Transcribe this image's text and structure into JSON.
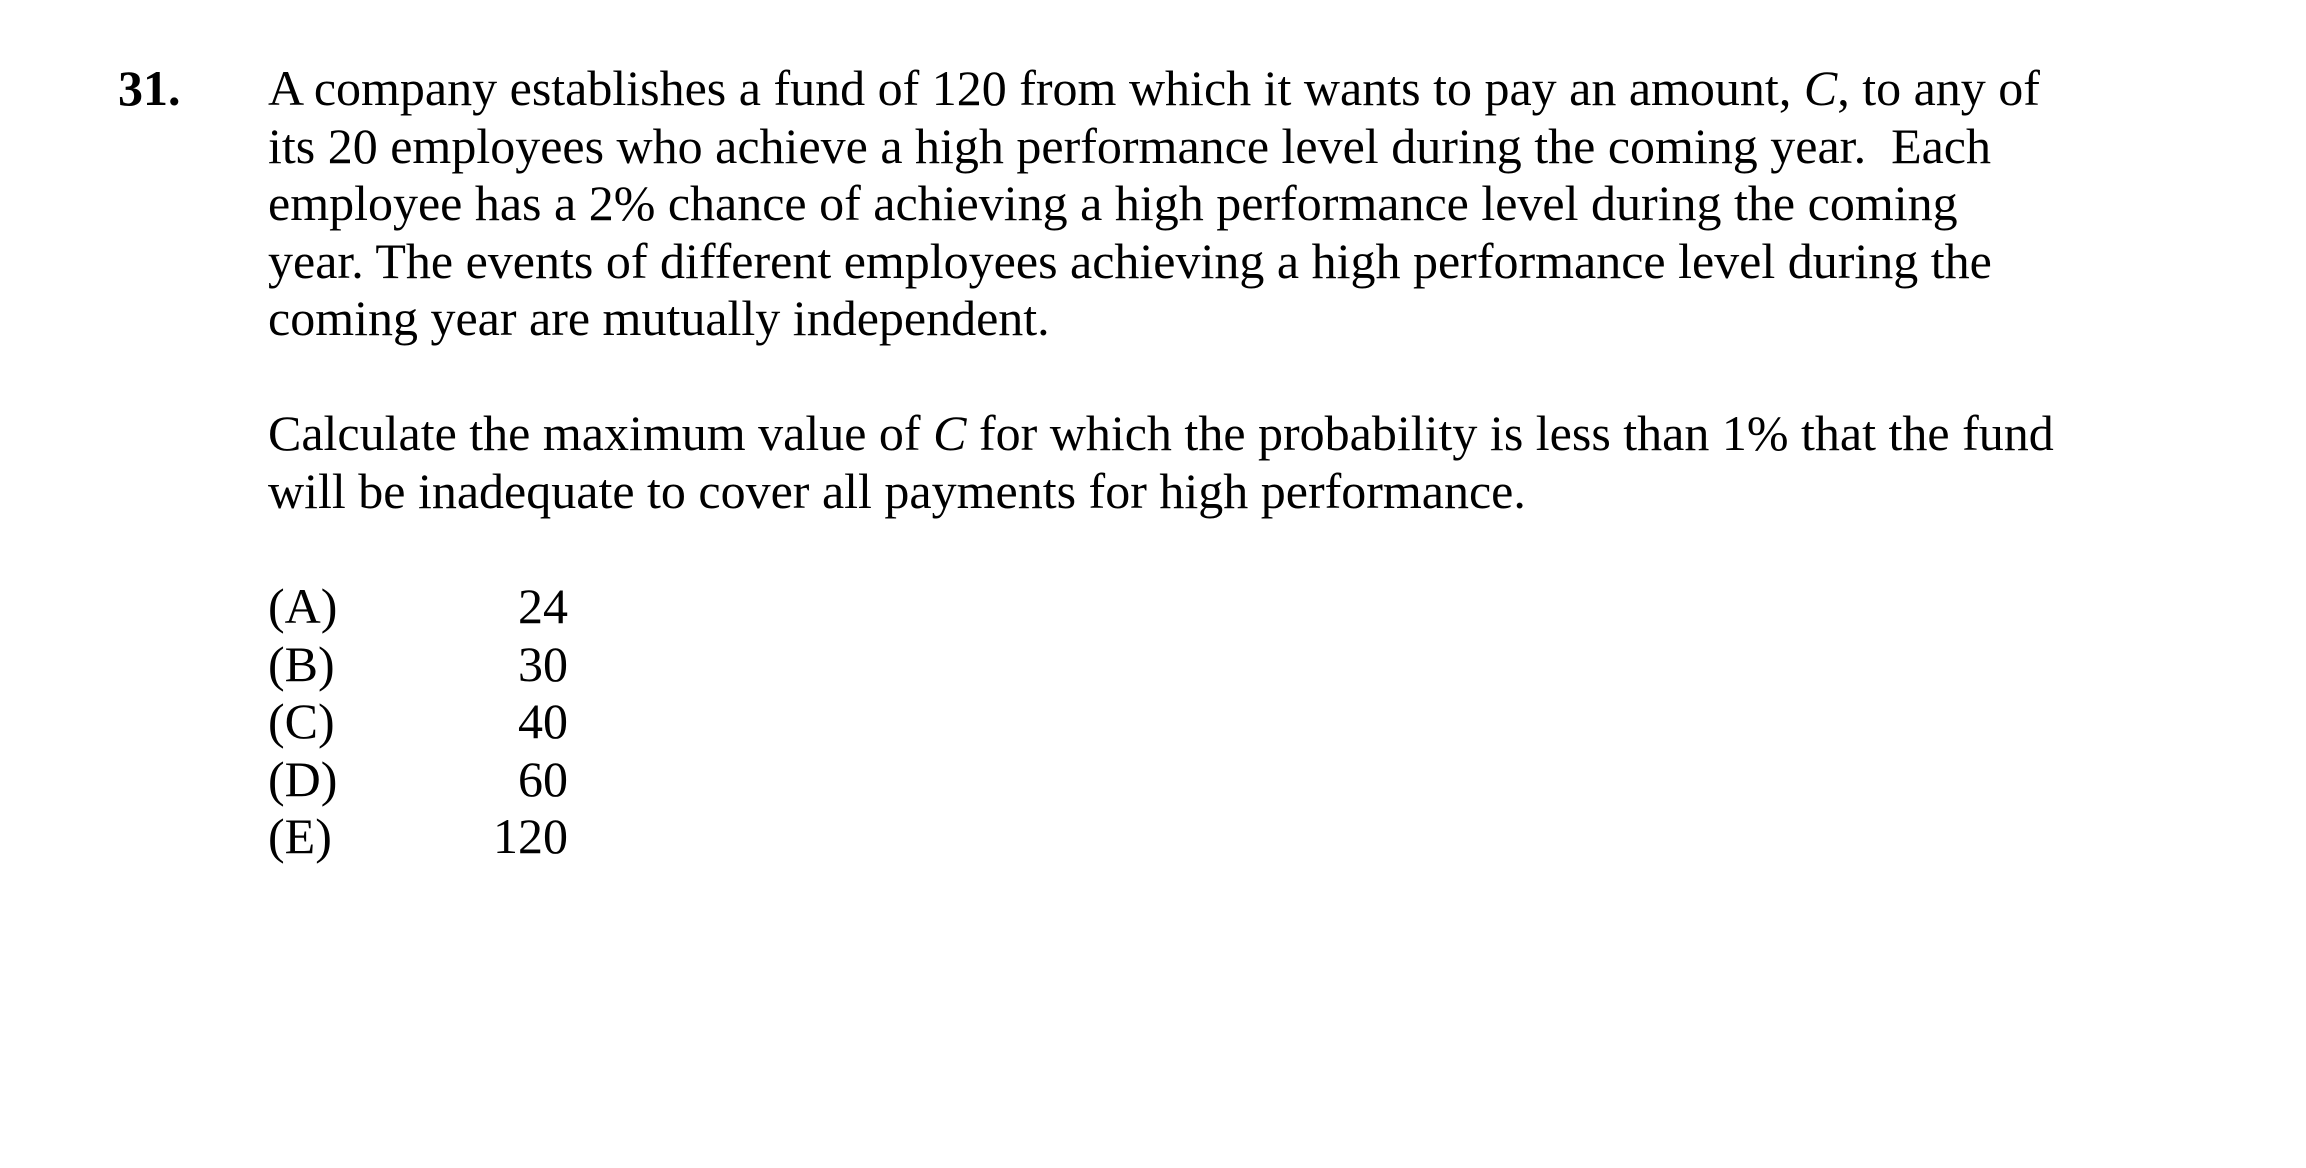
{
  "question": {
    "number": "31.",
    "stem_lines": [
      [
        "A company establishes a fund of 120 from which it wants to pay an amount, ",
        "C",
        ", to any of"
      ],
      [
        "its 20 employees who achieve a high performance level during the coming year.  Each",
        "",
        ""
      ],
      [
        "employee has a 2% chance of achieving a high performance level during the coming",
        "",
        ""
      ],
      [
        "year. The events of different employees achieving a high performance level during the",
        "",
        ""
      ],
      [
        "coming year are mutually independent.",
        "",
        ""
      ]
    ],
    "ask_lines": [
      [
        "Calculate the maximum value of ",
        "C",
        " for which the probability is less than 1% that the fund"
      ],
      [
        "will be inadequate to cover all payments for high performance.",
        "",
        ""
      ]
    ],
    "choices": [
      {
        "letter": "(A)",
        "value": "24"
      },
      {
        "letter": "(B)",
        "value": "30"
      },
      {
        "letter": "(C)",
        "value": "40"
      },
      {
        "letter": "(D)",
        "value": "60"
      },
      {
        "letter": "(E)",
        "value": "120"
      }
    ]
  }
}
